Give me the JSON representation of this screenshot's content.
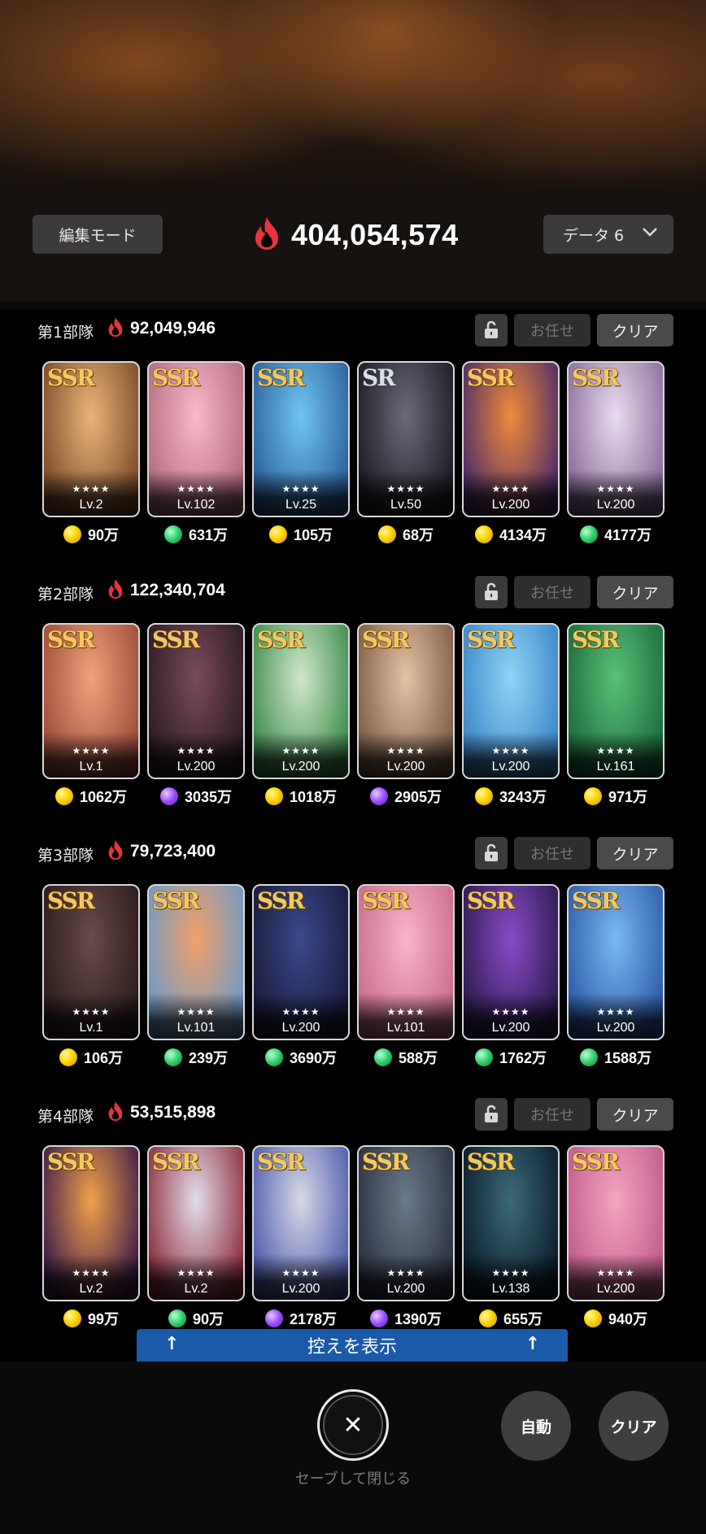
{
  "header": {
    "edit_mode_label": "編集モード",
    "total_power": "404,054,574",
    "data_select_label": "データ 6"
  },
  "squads": [
    {
      "name": "第1部隊",
      "power": "92,049,946",
      "auto_label": "お任せ",
      "clear_label": "クリア",
      "cards": [
        {
          "rarity": "SSR",
          "stars": "★★★★",
          "level": "Lv.2",
          "cost": "90万",
          "coin": "gold",
          "art": [
            "#e9b47a",
            "#7a4a28"
          ]
        },
        {
          "rarity": "SSR",
          "stars": "★★★★",
          "level": "Lv.102",
          "cost": "631万",
          "coin": "green",
          "art": [
            "#f7b9c9",
            "#b46a7e"
          ]
        },
        {
          "rarity": "SSR",
          "stars": "★★★★",
          "level": "Lv.25",
          "cost": "105万",
          "coin": "gold",
          "art": [
            "#6fc4f0",
            "#2a5e9a"
          ]
        },
        {
          "rarity": "SR",
          "stars": "★★★★",
          "level": "Lv.50",
          "cost": "68万",
          "coin": "gold",
          "art": [
            "#6a6a7a",
            "#1a1a22"
          ]
        },
        {
          "rarity": "SSR",
          "stars": "★★★★",
          "level": "Lv.200",
          "cost": "4134万",
          "coin": "gold",
          "art": [
            "#f08a3a",
            "#4a2a6a"
          ]
        },
        {
          "rarity": "SSR",
          "stars": "★★★★",
          "level": "Lv.200",
          "cost": "4177万",
          "coin": "green",
          "art": [
            "#e8dcef",
            "#8a6a9a"
          ]
        }
      ]
    },
    {
      "name": "第2部隊",
      "power": "122,340,704",
      "auto_label": "お任せ",
      "clear_label": "クリア",
      "cards": [
        {
          "rarity": "SSR",
          "stars": "★★★★",
          "level": "Lv.1",
          "cost": "1062万",
          "coin": "gold",
          "art": [
            "#f0a27a",
            "#9a4a3a"
          ]
        },
        {
          "rarity": "SSR",
          "stars": "★★★★",
          "level": "Lv.200",
          "cost": "3035万",
          "coin": "purple",
          "art": [
            "#7a4a5a",
            "#2a1a22"
          ]
        },
        {
          "rarity": "SSR",
          "stars": "★★★★",
          "level": "Lv.200",
          "cost": "1018万",
          "coin": "gold",
          "art": [
            "#cfe8c9",
            "#3a8a4a"
          ]
        },
        {
          "rarity": "SSR",
          "stars": "★★★★",
          "level": "Lv.200",
          "cost": "2905万",
          "coin": "purple",
          "art": [
            "#e6c2a4",
            "#7a5a44"
          ]
        },
        {
          "rarity": "SSR",
          "stars": "★★★★",
          "level": "Lv.200",
          "cost": "3243万",
          "coin": "gold",
          "art": [
            "#8fd4f4",
            "#3a84c8"
          ]
        },
        {
          "rarity": "SSR",
          "stars": "★★★★",
          "level": "Lv.161",
          "cost": "971万",
          "coin": "gold",
          "art": [
            "#5ac07a",
            "#1a6a3a"
          ]
        }
      ]
    },
    {
      "name": "第3部隊",
      "power": "79,723,400",
      "auto_label": "お任せ",
      "clear_label": "クリア",
      "cards": [
        {
          "rarity": "SSR",
          "stars": "★★★★",
          "level": "Lv.1",
          "cost": "106万",
          "coin": "gold",
          "art": [
            "#6a4a4a",
            "#2a1a1a"
          ]
        },
        {
          "rarity": "SSR",
          "stars": "★★★★",
          "level": "Lv.101",
          "cost": "239万",
          "coin": "green",
          "art": [
            "#f0a06a",
            "#6a9ac8"
          ]
        },
        {
          "rarity": "SSR",
          "stars": "★★★★",
          "level": "Lv.200",
          "cost": "3690万",
          "coin": "green",
          "art": [
            "#3a4a8a",
            "#1a1a3a"
          ]
        },
        {
          "rarity": "SSR",
          "stars": "★★★★",
          "level": "Lv.101",
          "cost": "588万",
          "coin": "green",
          "art": [
            "#f8b4c8",
            "#c86a8a"
          ]
        },
        {
          "rarity": "SSR",
          "stars": "★★★★",
          "level": "Lv.200",
          "cost": "1762万",
          "coin": "green",
          "art": [
            "#8a4ac8",
            "#2a1a4a"
          ]
        },
        {
          "rarity": "SSR",
          "stars": "★★★★",
          "level": "Lv.200",
          "cost": "1588万",
          "coin": "green",
          "art": [
            "#7ab8f0",
            "#2a5aa8"
          ]
        }
      ]
    },
    {
      "name": "第4部隊",
      "power": "53,515,898",
      "auto_label": "お任せ",
      "clear_label": "クリア",
      "cards": [
        {
          "rarity": "SSR",
          "stars": "★★★★",
          "level": "Lv.2",
          "cost": "99万",
          "coin": "gold",
          "art": [
            "#f0a04a",
            "#3a1a4a"
          ]
        },
        {
          "rarity": "SSR",
          "stars": "★★★★",
          "level": "Lv.2",
          "cost": "90万",
          "coin": "green",
          "art": [
            "#e4dcea",
            "#8a2a3a"
          ]
        },
        {
          "rarity": "SSR",
          "stars": "★★★★",
          "level": "Lv.200",
          "cost": "2178万",
          "coin": "purple",
          "art": [
            "#d8d8e8",
            "#4a5aa8"
          ]
        },
        {
          "rarity": "SSR",
          "stars": "★★★★",
          "level": "Lv.200",
          "cost": "1390万",
          "coin": "purple",
          "art": [
            "#6a7a8a",
            "#2a3040"
          ]
        },
        {
          "rarity": "SSR",
          "stars": "★★★★",
          "level": "Lv.138",
          "cost": "655万",
          "coin": "gold",
          "art": [
            "#3a6a7a",
            "#0a1a2a"
          ]
        },
        {
          "rarity": "SSR",
          "stars": "★★★★",
          "level": "Lv.200",
          "cost": "940万",
          "coin": "gold",
          "art": [
            "#f4a4c0",
            "#c05a8a"
          ]
        }
      ]
    }
  ],
  "reserve_bar_label": "控えを表示",
  "footer": {
    "close_caption": "セーブして閉じる",
    "auto_label": "自動",
    "clear_label": "クリア"
  }
}
